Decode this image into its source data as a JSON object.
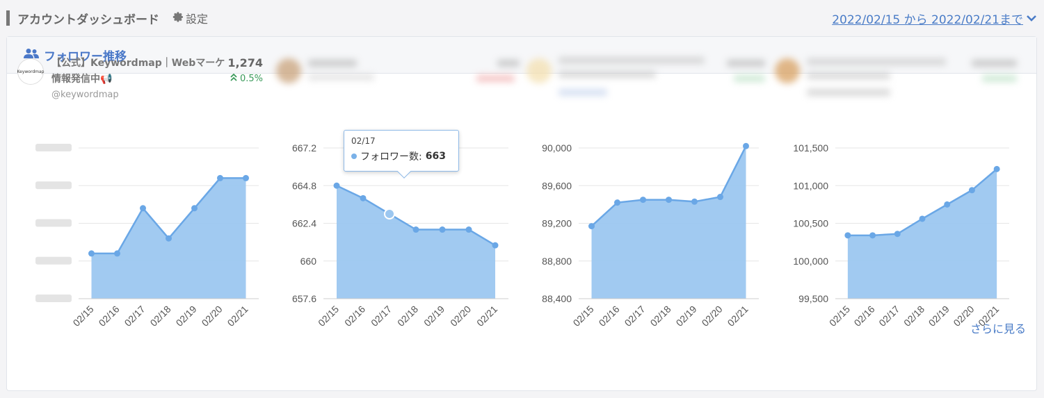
{
  "header": {
    "title": "アカウントダッシュボード",
    "settings_label": "設定",
    "date_range": "2022/02/15 から 2022/02/21まで"
  },
  "panel": {
    "title": "フォロワー推移",
    "more_label": "さらに見る"
  },
  "account": {
    "name": "【公式】Keywordmap｜Webマーケ情報発信中📢",
    "handle": "@keywordmap",
    "followers": "1,274",
    "change": "0.5%",
    "avatar_text": "Keywordmap"
  },
  "colors": {
    "accent": "#4a78c8",
    "area_fill": "#9cc7f0",
    "area_line": "#6aa7e6",
    "up": "#3a9a5a"
  },
  "tooltip": {
    "date": "02/17",
    "series": "フォロワー数",
    "value": "663"
  },
  "chart_data": [
    {
      "type": "area",
      "categories": [
        "02/15",
        "02/16",
        "02/17",
        "02/18",
        "02/19",
        "02/20",
        "02/21"
      ],
      "values": [
        1269,
        1269,
        1272,
        1270,
        1272,
        1274,
        1274
      ],
      "ylim": [
        1266,
        1276
      ],
      "yticks": [],
      "series": [
        {
          "name": "フォロワー数"
        }
      ]
    },
    {
      "type": "area",
      "categories": [
        "02/15",
        "02/16",
        "02/17",
        "02/18",
        "02/19",
        "02/20",
        "02/21"
      ],
      "values": [
        664.8,
        664,
        663,
        662,
        662,
        662,
        661
      ],
      "ylim": [
        657.6,
        667.2
      ],
      "yticks": [
        "667.2",
        "664.8",
        "662.4",
        "660",
        "657.6"
      ],
      "series": [
        {
          "name": "フォロワー数"
        }
      ]
    },
    {
      "type": "area",
      "categories": [
        "02/15",
        "02/16",
        "02/17",
        "02/18",
        "02/19",
        "02/20",
        "02/21"
      ],
      "values": [
        89170,
        89420,
        89450,
        89450,
        89430,
        89480,
        90020
      ],
      "ylim": [
        88400,
        90000
      ],
      "yticks": [
        "90,000",
        "89,600",
        "89,200",
        "88,800",
        "88,400"
      ],
      "series": [
        {
          "name": "フォロワー数"
        }
      ]
    },
    {
      "type": "area",
      "categories": [
        "02/15",
        "02/16",
        "02/17",
        "02/18",
        "02/19",
        "02/20",
        "02/21"
      ],
      "values": [
        100340,
        100340,
        100360,
        100560,
        100750,
        100940,
        101220
      ],
      "ylim": [
        99500,
        101500
      ],
      "yticks": [
        "101,500",
        "101,000",
        "100,500",
        "100,000",
        "99,500"
      ],
      "series": [
        {
          "name": "フォロワー数"
        }
      ]
    }
  ]
}
